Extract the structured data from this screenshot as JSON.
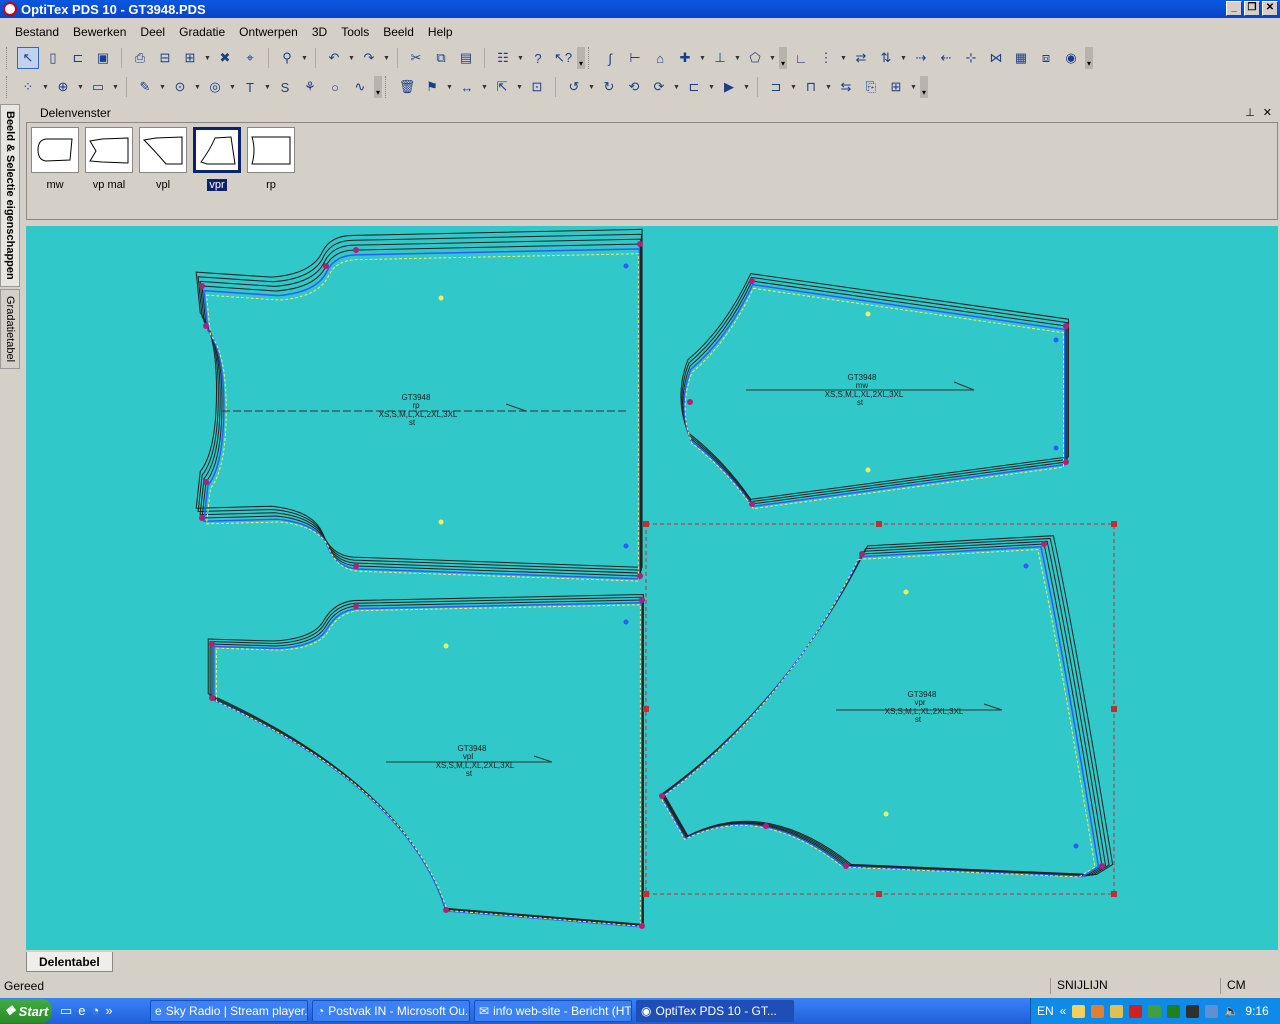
{
  "window": {
    "title": "OptiTex PDS 10 - GT3948.PDS"
  },
  "menu": [
    "Bestand",
    "Bewerken",
    "Deel",
    "Gradatie",
    "Ontwerpen",
    "3D",
    "Tools",
    "Beeld",
    "Help"
  ],
  "side_tabs": [
    "Beeld & Selectie eigenschappen",
    "Gradatietabel"
  ],
  "panel": {
    "title": "Delenvenster"
  },
  "pieces": [
    {
      "label": "mw",
      "selected": false
    },
    {
      "label": "vp mal",
      "selected": false
    },
    {
      "label": "vpl",
      "selected": false
    },
    {
      "label": "vpr",
      "selected": true
    },
    {
      "label": "rp",
      "selected": false
    }
  ],
  "canvas": {
    "background": "#30c8c8",
    "pattern_labels": [
      {
        "model": "GT3948",
        "piece": "rp",
        "sizes": "XS,S,M,L,XL,2XL,3XL",
        "note": "st"
      },
      {
        "model": "GT3948",
        "piece": "mw",
        "sizes": "XS,S,M,L,XL,2XL,3XL",
        "note": "st"
      },
      {
        "model": "GT3948",
        "piece": "vpl",
        "sizes": "XS,S,M,L,XL,2XL,3XL",
        "note": "st"
      },
      {
        "model": "GT3948",
        "piece": "vpr",
        "sizes": "XS,S,M,L,XL,2XL,3XL",
        "note": "st"
      }
    ]
  },
  "bottom_tab": "Delentabel",
  "status": {
    "left": "Gereed",
    "mode": "SNIJLIJN",
    "unit": "CM"
  },
  "taskbar": {
    "start": "Start",
    "tasks": [
      {
        "label": "Sky Radio | Stream player...",
        "active": false
      },
      {
        "label": "Postvak IN - Microsoft Ou...",
        "active": false
      },
      {
        "label": "info web-site - Bericht (HT...",
        "active": false
      },
      {
        "label": "OptiTex PDS 10 - GT...",
        "active": true
      }
    ],
    "lang": "EN",
    "clock": "9:16"
  },
  "colors": {
    "line_dark": "#222222",
    "line_blue": "#2a5cff",
    "point_magenta": "#b0207a",
    "point_yellow": "#f2f25a",
    "selection": "#c03030"
  }
}
